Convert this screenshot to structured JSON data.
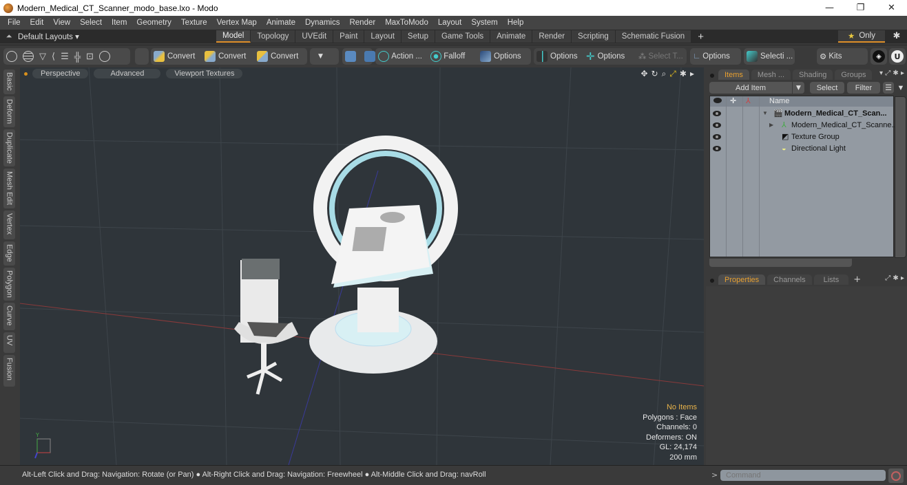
{
  "window": {
    "title": "Modern_Medical_CT_Scanner_modo_base.lxo - Modo",
    "controls": {
      "minimize": "—",
      "restore": "❐",
      "close": "✕"
    }
  },
  "menu": [
    "File",
    "Edit",
    "View",
    "Select",
    "Item",
    "Geometry",
    "Texture",
    "Vertex Map",
    "Animate",
    "Dynamics",
    "Render",
    "MaxToModo",
    "Layout",
    "System",
    "Help"
  ],
  "layoutbar": {
    "layouts_label": "Default Layouts ▾",
    "tabs": [
      "Model",
      "Topology",
      "UVEdit",
      "Paint",
      "Layout",
      "Setup",
      "Game Tools",
      "Animate",
      "Render",
      "Scripting",
      "Schematic Fusion"
    ],
    "active_tab": "Model",
    "add_tab": "+",
    "only_label": "Only",
    "star": "★",
    "gear": "✱"
  },
  "toolbar": {
    "convert1": "Convert",
    "convert2": "Convert",
    "convert3": "Convert",
    "action": "Action",
    "action_more": "...",
    "falloff": "Falloff",
    "options1": "Options",
    "options2": "Options",
    "options3": "Options",
    "select_t": "Select T...",
    "options4": "Options",
    "selecti": "Selecti ...",
    "kits": "Kits"
  },
  "viewport": {
    "view_mode": "Perspective",
    "shading": "Advanced",
    "textures": "Viewport Textures",
    "info": {
      "selection": "No Items",
      "polygons": "Polygons : Face",
      "channels": "Channels: 0",
      "deformers": "Deformers: ON",
      "gl": "GL: 24,174",
      "grid": "200 mm"
    },
    "axis_label": "Y"
  },
  "left_tabs": [
    "Basic",
    "Deform",
    "Duplicate",
    "Mesh Edit",
    "Vertex",
    "Edge",
    "Polygon",
    "Curve",
    "UV",
    "Fusion"
  ],
  "items_panel": {
    "tabs": [
      "Items",
      "Mesh ...",
      "Shading",
      "Groups"
    ],
    "active_tab": "Items",
    "add_item": "Add Item",
    "select": "Select",
    "filter": "Filter",
    "column_name": "Name",
    "rows": [
      {
        "name": "Modern_Medical_CT_Scan...",
        "type": "scene",
        "expander": "▼",
        "bold": true
      },
      {
        "name": "Modern_Medical_CT_Scanne...",
        "type": "mesh",
        "expander": "▶",
        "bold": false
      },
      {
        "name": "Texture Group",
        "type": "texture-group",
        "expander": "",
        "bold": false
      },
      {
        "name": "Directional Light",
        "type": "light",
        "expander": "",
        "bold": false
      }
    ]
  },
  "properties_panel": {
    "tabs": [
      "Properties",
      "Channels",
      "Lists"
    ],
    "active_tab": "Properties",
    "add_tab": "+"
  },
  "statusbar": {
    "hint": "Alt-Left Click and Drag: Navigation: Rotate (or Pan) ● Alt-Right Click and Drag: Navigation: Freewheel ● Alt-Middle Click and Drag: navRoll"
  },
  "command": {
    "prompt": ">",
    "placeholder": "Command"
  },
  "colors": {
    "accent": "#e0902a",
    "viewport_bg": "#2f353a",
    "tree_bg": "#939aa2",
    "info_highlight": "#e8b34a"
  }
}
